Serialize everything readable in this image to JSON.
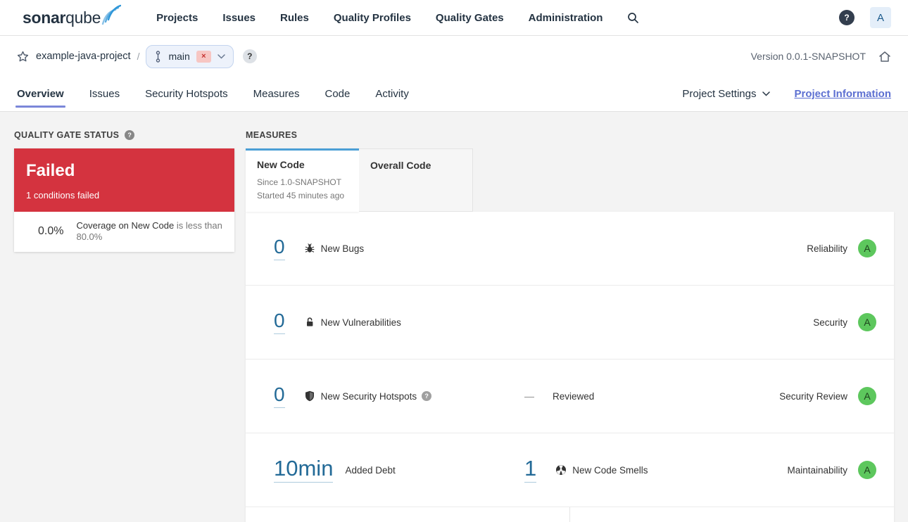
{
  "nav": {
    "logo": {
      "bold": "sonar",
      "regular": "qube"
    },
    "items": [
      "Projects",
      "Issues",
      "Rules",
      "Quality Profiles",
      "Quality Gates",
      "Administration"
    ],
    "help_label": "?",
    "avatar_label": "A"
  },
  "breadcrumb": {
    "project": "example-java-project",
    "separator": "/",
    "branch": {
      "name": "main",
      "close": "×"
    },
    "help_label": "?",
    "version": "Version 0.0.1-SNAPSHOT"
  },
  "tabs": {
    "items": [
      {
        "label": "Overview",
        "active": true
      },
      {
        "label": "Issues",
        "active": false
      },
      {
        "label": "Security Hotspots",
        "active": false
      },
      {
        "label": "Measures",
        "active": false
      },
      {
        "label": "Code",
        "active": false
      },
      {
        "label": "Activity",
        "active": false
      }
    ],
    "project_settings": "Project Settings",
    "project_information": "Project Information"
  },
  "quality_gate": {
    "title": "QUALITY GATE STATUS",
    "help_label": "?",
    "status": "Failed",
    "subtitle": "1 conditions failed",
    "condition": {
      "value": "0.0%",
      "metric": "Coverage on New Code",
      "comparison": "is less than 80.0%"
    }
  },
  "measures": {
    "title": "MEASURES",
    "tabs": {
      "new_code": {
        "label": "New Code",
        "since": "Since 1.0-SNAPSHOT",
        "started": "Started 45 minutes ago"
      },
      "overall_code": {
        "label": "Overall Code"
      }
    },
    "rows": [
      {
        "value": "0",
        "label": "New Bugs",
        "category": "Reliability",
        "rating": "A"
      },
      {
        "value": "0",
        "label": "New Vulnerabilities",
        "category": "Security",
        "rating": "A"
      },
      {
        "value": "0",
        "label": "New Security Hotspots",
        "help_label": "?",
        "reviewed_dash": "—",
        "reviewed_label": "Reviewed",
        "category": "Security Review",
        "rating": "A"
      },
      {
        "value": "10min",
        "label": "Added Debt",
        "value2": "1",
        "label2": "New Code Smells",
        "category": "Maintainability",
        "rating": "A"
      }
    ]
  },
  "colors": {
    "failed_red": "#d4333f",
    "link_blue": "#236a97",
    "rating_a_green": "#5dc75d",
    "active_tab_blue": "#4b9fd5",
    "accent_indigo": "#5c6fd1"
  }
}
